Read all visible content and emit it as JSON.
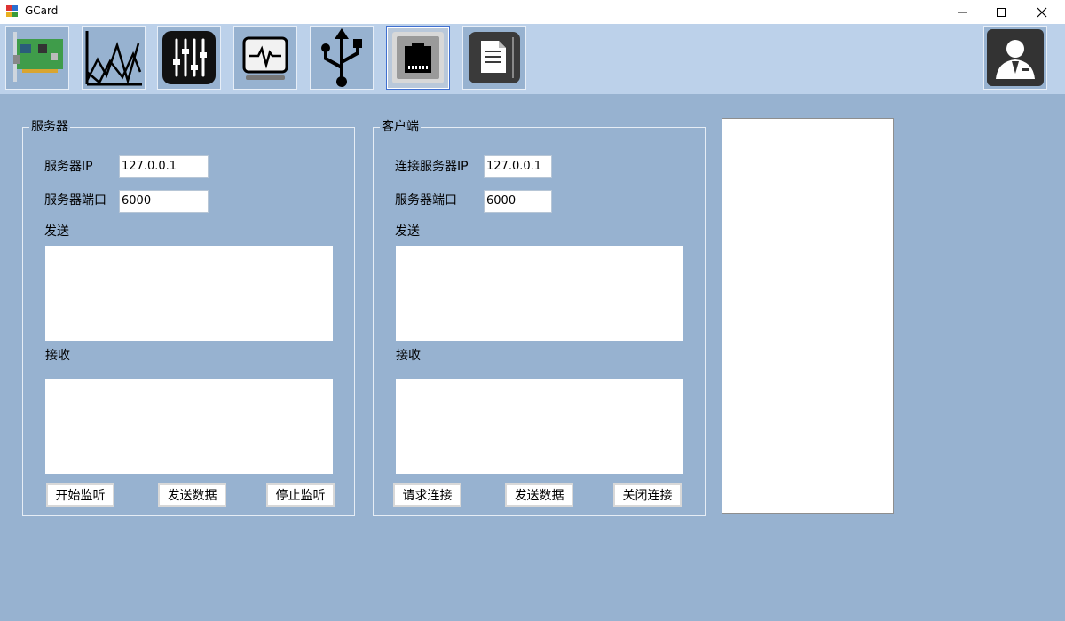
{
  "window": {
    "title": "GCard"
  },
  "toolbar": {
    "icons": [
      "network-card-icon",
      "chart-icon",
      "sliders-icon",
      "monitor-pulse-icon",
      "usb-icon",
      "ethernet-port-icon",
      "document-icon",
      "user-icon"
    ],
    "selected": "ethernet-port-icon"
  },
  "server": {
    "group_title": "服务器",
    "ip_label": "服务器IP",
    "ip_value": "127.0.0.1",
    "port_label": "服务器端口",
    "port_value": "6000",
    "send_label": "发送",
    "recv_label": "接收",
    "buttons": [
      "开始监听",
      "发送数据",
      "停止监听"
    ]
  },
  "client": {
    "group_title": "客户端",
    "ip_label": "连接服务器IP",
    "ip_value": "127.0.0.1",
    "port_label": "服务器端口",
    "port_value": "6000",
    "send_label": "发送",
    "recv_label": "接收",
    "buttons": [
      "请求连接",
      "发送数据",
      "关闭连接"
    ]
  }
}
